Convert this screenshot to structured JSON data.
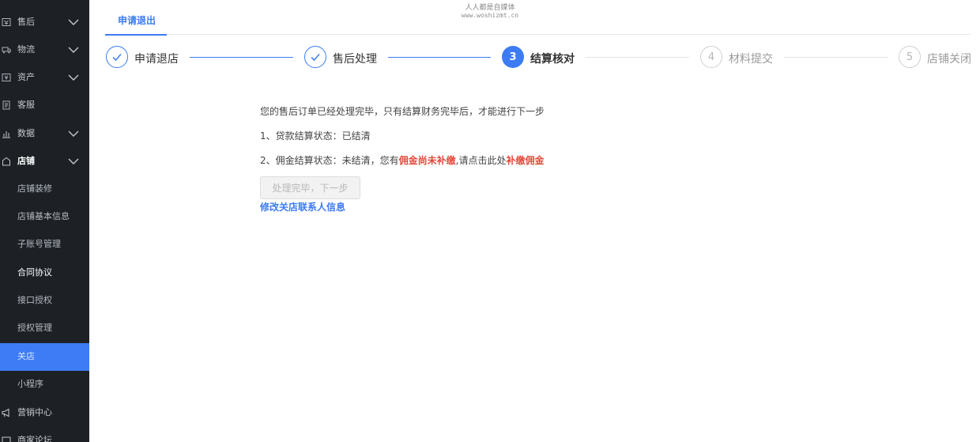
{
  "watermark": {
    "line1": "人人都是自媒体",
    "line2": "www.woshizmt.cn"
  },
  "sidebar": {
    "items": [
      {
        "label": "售后",
        "icon": "aftersale-icon"
      },
      {
        "label": "物流",
        "icon": "truck-icon"
      },
      {
        "label": "资产",
        "icon": "yen-icon"
      },
      {
        "label": "客服",
        "icon": "document-icon"
      },
      {
        "label": "数据",
        "icon": "bar-chart-icon"
      },
      {
        "label": "店铺",
        "icon": "store-icon"
      }
    ],
    "sub_items": [
      {
        "label": "店铺装修"
      },
      {
        "label": "店铺基本信息"
      },
      {
        "label": "子账号管理"
      },
      {
        "label": "合同协议"
      },
      {
        "label": "接口授权"
      },
      {
        "label": "授权管理"
      },
      {
        "label": "关店"
      },
      {
        "label": "小程序"
      }
    ],
    "bottom_items": [
      {
        "label": "营销中心",
        "icon": "megaphone-icon"
      },
      {
        "label": "商家论坛",
        "icon": "forum-icon"
      }
    ],
    "active_color": "#3d7cf5"
  },
  "tabs": {
    "active_label": "申请退出"
  },
  "steps": [
    {
      "number": "1",
      "label": "申请退店",
      "status": "done"
    },
    {
      "number": "2",
      "label": "售后处理",
      "status": "done"
    },
    {
      "number": "3",
      "label": "结算核对",
      "status": "current"
    },
    {
      "number": "4",
      "label": "材料提交",
      "status": "pending"
    },
    {
      "number": "5",
      "label": "店铺关闭",
      "status": "pending"
    }
  ],
  "content": {
    "intro": "您的售后订单已经处理完毕，只有结算财务完毕后，才能进行下一步",
    "line1_prefix": "1、贷款结算状态：",
    "line1_value": "已结清",
    "line2_prefix": "2、佣金结算状态：未结清，您有",
    "line2_highlight": "佣金尚未补缴",
    "line2_mid": ",请点击此处",
    "line2_link": "补缴佣金",
    "next_button": "处理完毕，下一步",
    "edit_link": "修改关店联系人信息"
  },
  "colors": {
    "accent": "#3d7cf5",
    "warning": "#e4483a",
    "sidebar_bg": "#1d2126"
  }
}
